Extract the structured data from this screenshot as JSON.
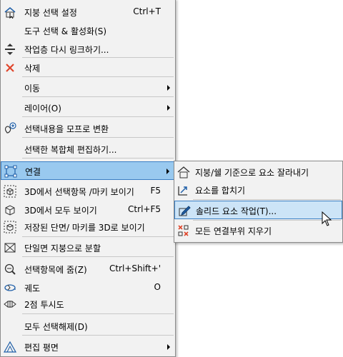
{
  "main_menu": {
    "items": [
      {
        "label": "지붕 선택 설정",
        "shortcut": "Ctrl+T",
        "icon": "roof-select-settings-icon"
      },
      {
        "label": "도구 선택 & 활성화(S)",
        "shortcut": "",
        "icon": ""
      },
      {
        "label": "작업층 다시 링크하기...",
        "shortcut": "",
        "icon": "relink-story-icon"
      },
      {
        "label": "삭제",
        "shortcut": "",
        "icon": "delete-x-icon"
      },
      {
        "label": "이동",
        "shortcut": "",
        "icon": ""
      },
      {
        "label": "레이어(O)",
        "shortcut": "",
        "icon": ""
      },
      {
        "label": "선택내용을 모프로 변환",
        "shortcut": "",
        "icon": "convert-to-morph-icon"
      },
      {
        "label": "선택한 복합체 편집하기...",
        "shortcut": "",
        "icon": ""
      },
      {
        "label": "연결",
        "shortcut": "",
        "icon": "connect-icon"
      },
      {
        "label": "3D에서 선택항목 /마키 보이기",
        "shortcut": "F5",
        "icon": "3d-selection-icon"
      },
      {
        "label": "3D에서 모두 보이기",
        "shortcut": "Ctrl+F5",
        "icon": "3d-all-icon"
      },
      {
        "label": "저장된 단면/ 마키를 3D로 보이기",
        "shortcut": "",
        "icon": "saved-section-3d-icon"
      },
      {
        "label": "단일면 지붕으로 분할",
        "shortcut": "",
        "icon": "split-roof-icon"
      },
      {
        "label": "선택항목에 줌(Z)",
        "shortcut": "Ctrl+Shift+'",
        "icon": "zoom-selection-icon"
      },
      {
        "label": "궤도",
        "shortcut": "O",
        "icon": "orbit-icon"
      },
      {
        "label": "2점 투시도",
        "shortcut": "",
        "icon": "two-point-perspective-icon"
      },
      {
        "label": "모두 선택해제(D)",
        "shortcut": "",
        "icon": ""
      },
      {
        "label": "편집 평면",
        "shortcut": "",
        "icon": "edit-plane-icon"
      }
    ]
  },
  "sub_menu": {
    "items": [
      {
        "label": "지붕/쉘 기준으로 요소 잘라내기",
        "icon": "trim-to-roof-icon"
      },
      {
        "label": "요소를 합치기",
        "icon": "merge-elements-icon"
      },
      {
        "label": "솔리드 요소 작업(T)...",
        "icon": "solid-operations-icon"
      },
      {
        "label": "모든 연결부위 지우기",
        "icon": "remove-connections-icon"
      }
    ]
  },
  "colors": {
    "menu_bg": "#f2f2f2",
    "highlight": "#99c9ef",
    "highlight_border": "#3a7fc4",
    "icon_blue": "#1f5fa8",
    "delete_red": "#e0452b"
  }
}
